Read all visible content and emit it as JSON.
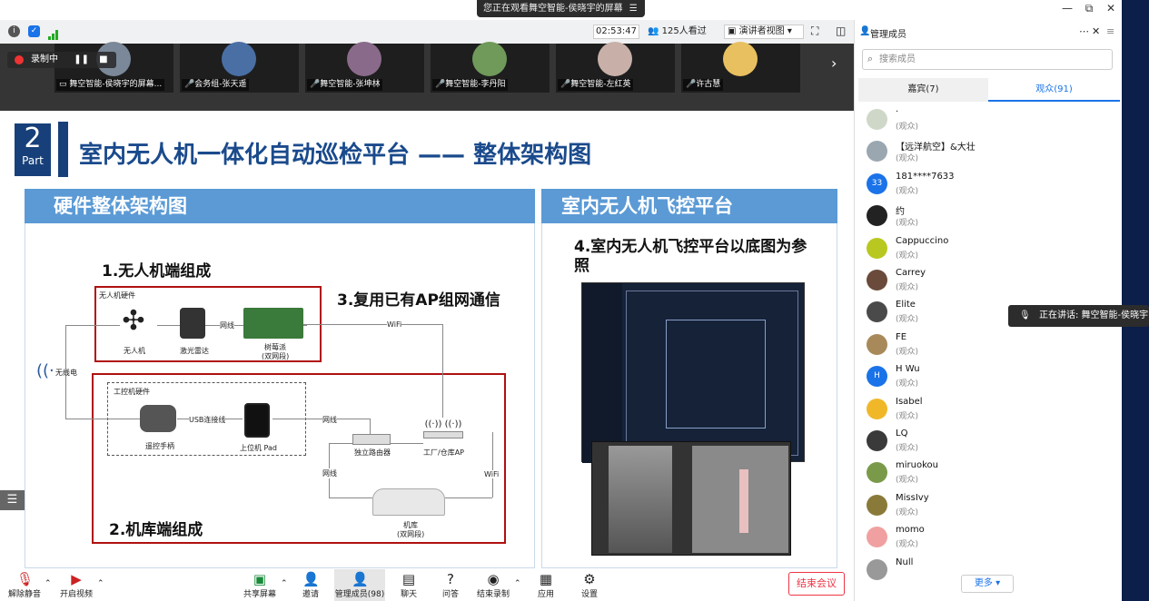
{
  "notice": {
    "text": "您正在观看舞空智能-侯晓宇的屏幕",
    "icon": "hamburger-icon"
  },
  "window": {
    "minimize": "—",
    "restore": "⧉",
    "close": "✕"
  },
  "toolbar": {
    "timer": "02:53:47",
    "viewers": "125人看过",
    "view_mode": "演讲者视图"
  },
  "recording": {
    "label": "录制中"
  },
  "participants": [
    {
      "name": "舞空智能-侯晓宇的屏幕...",
      "avatar_color": "#7a8899"
    },
    {
      "name": "会务组-张天遥",
      "avatar_color": "#4a6fa5"
    },
    {
      "name": "舞空智能-张坤林",
      "avatar_color": "#8a6a8a"
    },
    {
      "name": "舞空智能-李丹阳",
      "avatar_color": "#6f9a5a"
    },
    {
      "name": "舞空智能-左红英",
      "avatar_color": "#c8b0a8"
    },
    {
      "name": "许古慧",
      "avatar_color": "#e8c060"
    }
  ],
  "slide": {
    "part_number": "2",
    "part_label": "Part",
    "title": "室内无人机一体化自动巡检平台 —— 整体架构图",
    "left_panel": {
      "header": "硬件整体架构图",
      "h1": "1.无人机端组成",
      "h2": "2.机库端组成",
      "h3": "3.复用已有AP组网通信",
      "drone_hw_label": "无人机硬件",
      "ctrl_hw_label": "工控机硬件",
      "drone": "无人机",
      "lidar": "激光雷达",
      "pi": "树莓派",
      "pi_sub": "(双网段)",
      "net1": "网线",
      "wifi1": "WiFi",
      "wireless": "无线电",
      "remote": "遥控手柄",
      "usb": "USB连接线",
      "pad": "上位机 Pad",
      "net2": "网线",
      "router": "独立路由器",
      "ap": "工厂/仓库AP",
      "net3": "网线",
      "wifi2": "WiFi",
      "hangar": "机库",
      "hangar_sub": "(双网段)"
    },
    "right_panel": {
      "header": "室内无人机飞控平台",
      "caption": "4.室内无人机飞控平台以底图为参照"
    }
  },
  "bottom_toolbar": [
    {
      "label": "解除静音",
      "icon": "mic-muted-icon"
    },
    {
      "label": "开启视频",
      "icon": "camera-off-icon"
    },
    {
      "label": "共享屏幕",
      "icon": "share-screen-icon"
    },
    {
      "label": "邀请",
      "icon": "invite-icon"
    },
    {
      "label": "管理成员(98)",
      "icon": "members-icon"
    },
    {
      "label": "聊天",
      "icon": "chat-icon"
    },
    {
      "label": "问答",
      "icon": "qa-icon"
    },
    {
      "label": "结束录制",
      "icon": "stop-record-icon"
    },
    {
      "label": "应用",
      "icon": "apps-icon"
    },
    {
      "label": "设置",
      "icon": "settings-icon"
    }
  ],
  "end_meeting": "结束会议",
  "panel": {
    "title": "管理成员",
    "search_placeholder": "搜索成员",
    "tab_guests": "嘉宾(7)",
    "tab_audience": "观众(91)",
    "more": "更多 ▾",
    "members": [
      {
        "name": "·",
        "role": "(观众)",
        "avatar_color": "#cfd8c8",
        "avatar_text": ""
      },
      {
        "name": "【远洋航空】&大壮",
        "role": "(观众)",
        "avatar_color": "#9aa7b0",
        "avatar_text": ""
      },
      {
        "name": "181****7633",
        "role": "(观众)",
        "avatar_color": "#1a73e8",
        "avatar_text": "33"
      },
      {
        "name": "约",
        "role": "(观众)",
        "avatar_color": "#222222",
        "avatar_text": ""
      },
      {
        "name": "Cappuccino",
        "role": "(观众)",
        "avatar_color": "#b8c820",
        "avatar_text": ""
      },
      {
        "name": "Carrey",
        "role": "(观众)",
        "avatar_color": "#6a4a3a",
        "avatar_text": ""
      },
      {
        "name": "Elite",
        "role": "(观众)",
        "avatar_color": "#4a4a4a",
        "avatar_text": ""
      },
      {
        "name": "FE",
        "role": "(观众)",
        "avatar_color": "#a88a5a",
        "avatar_text": ""
      },
      {
        "name": "H Wu",
        "role": "(观众)",
        "avatar_color": "#1a73e8",
        "avatar_text": "H"
      },
      {
        "name": "Isabel",
        "role": "(观众)",
        "avatar_color": "#f0b828",
        "avatar_text": ""
      },
      {
        "name": "LQ",
        "role": "(观众)",
        "avatar_color": "#3a3a3a",
        "avatar_text": ""
      },
      {
        "name": "miruokou",
        "role": "(观众)",
        "avatar_color": "#7a9a4a",
        "avatar_text": ""
      },
      {
        "name": "MissIvy",
        "role": "(观众)",
        "avatar_color": "#8a7a3a",
        "avatar_text": ""
      },
      {
        "name": "momo",
        "role": "(观众)",
        "avatar_color": "#f0a0a0",
        "avatar_text": ""
      },
      {
        "name": "Null",
        "role": "",
        "avatar_color": "#999999",
        "avatar_text": ""
      }
    ]
  },
  "speaking": "正在讲话: 舞空智能-侯晓宇"
}
